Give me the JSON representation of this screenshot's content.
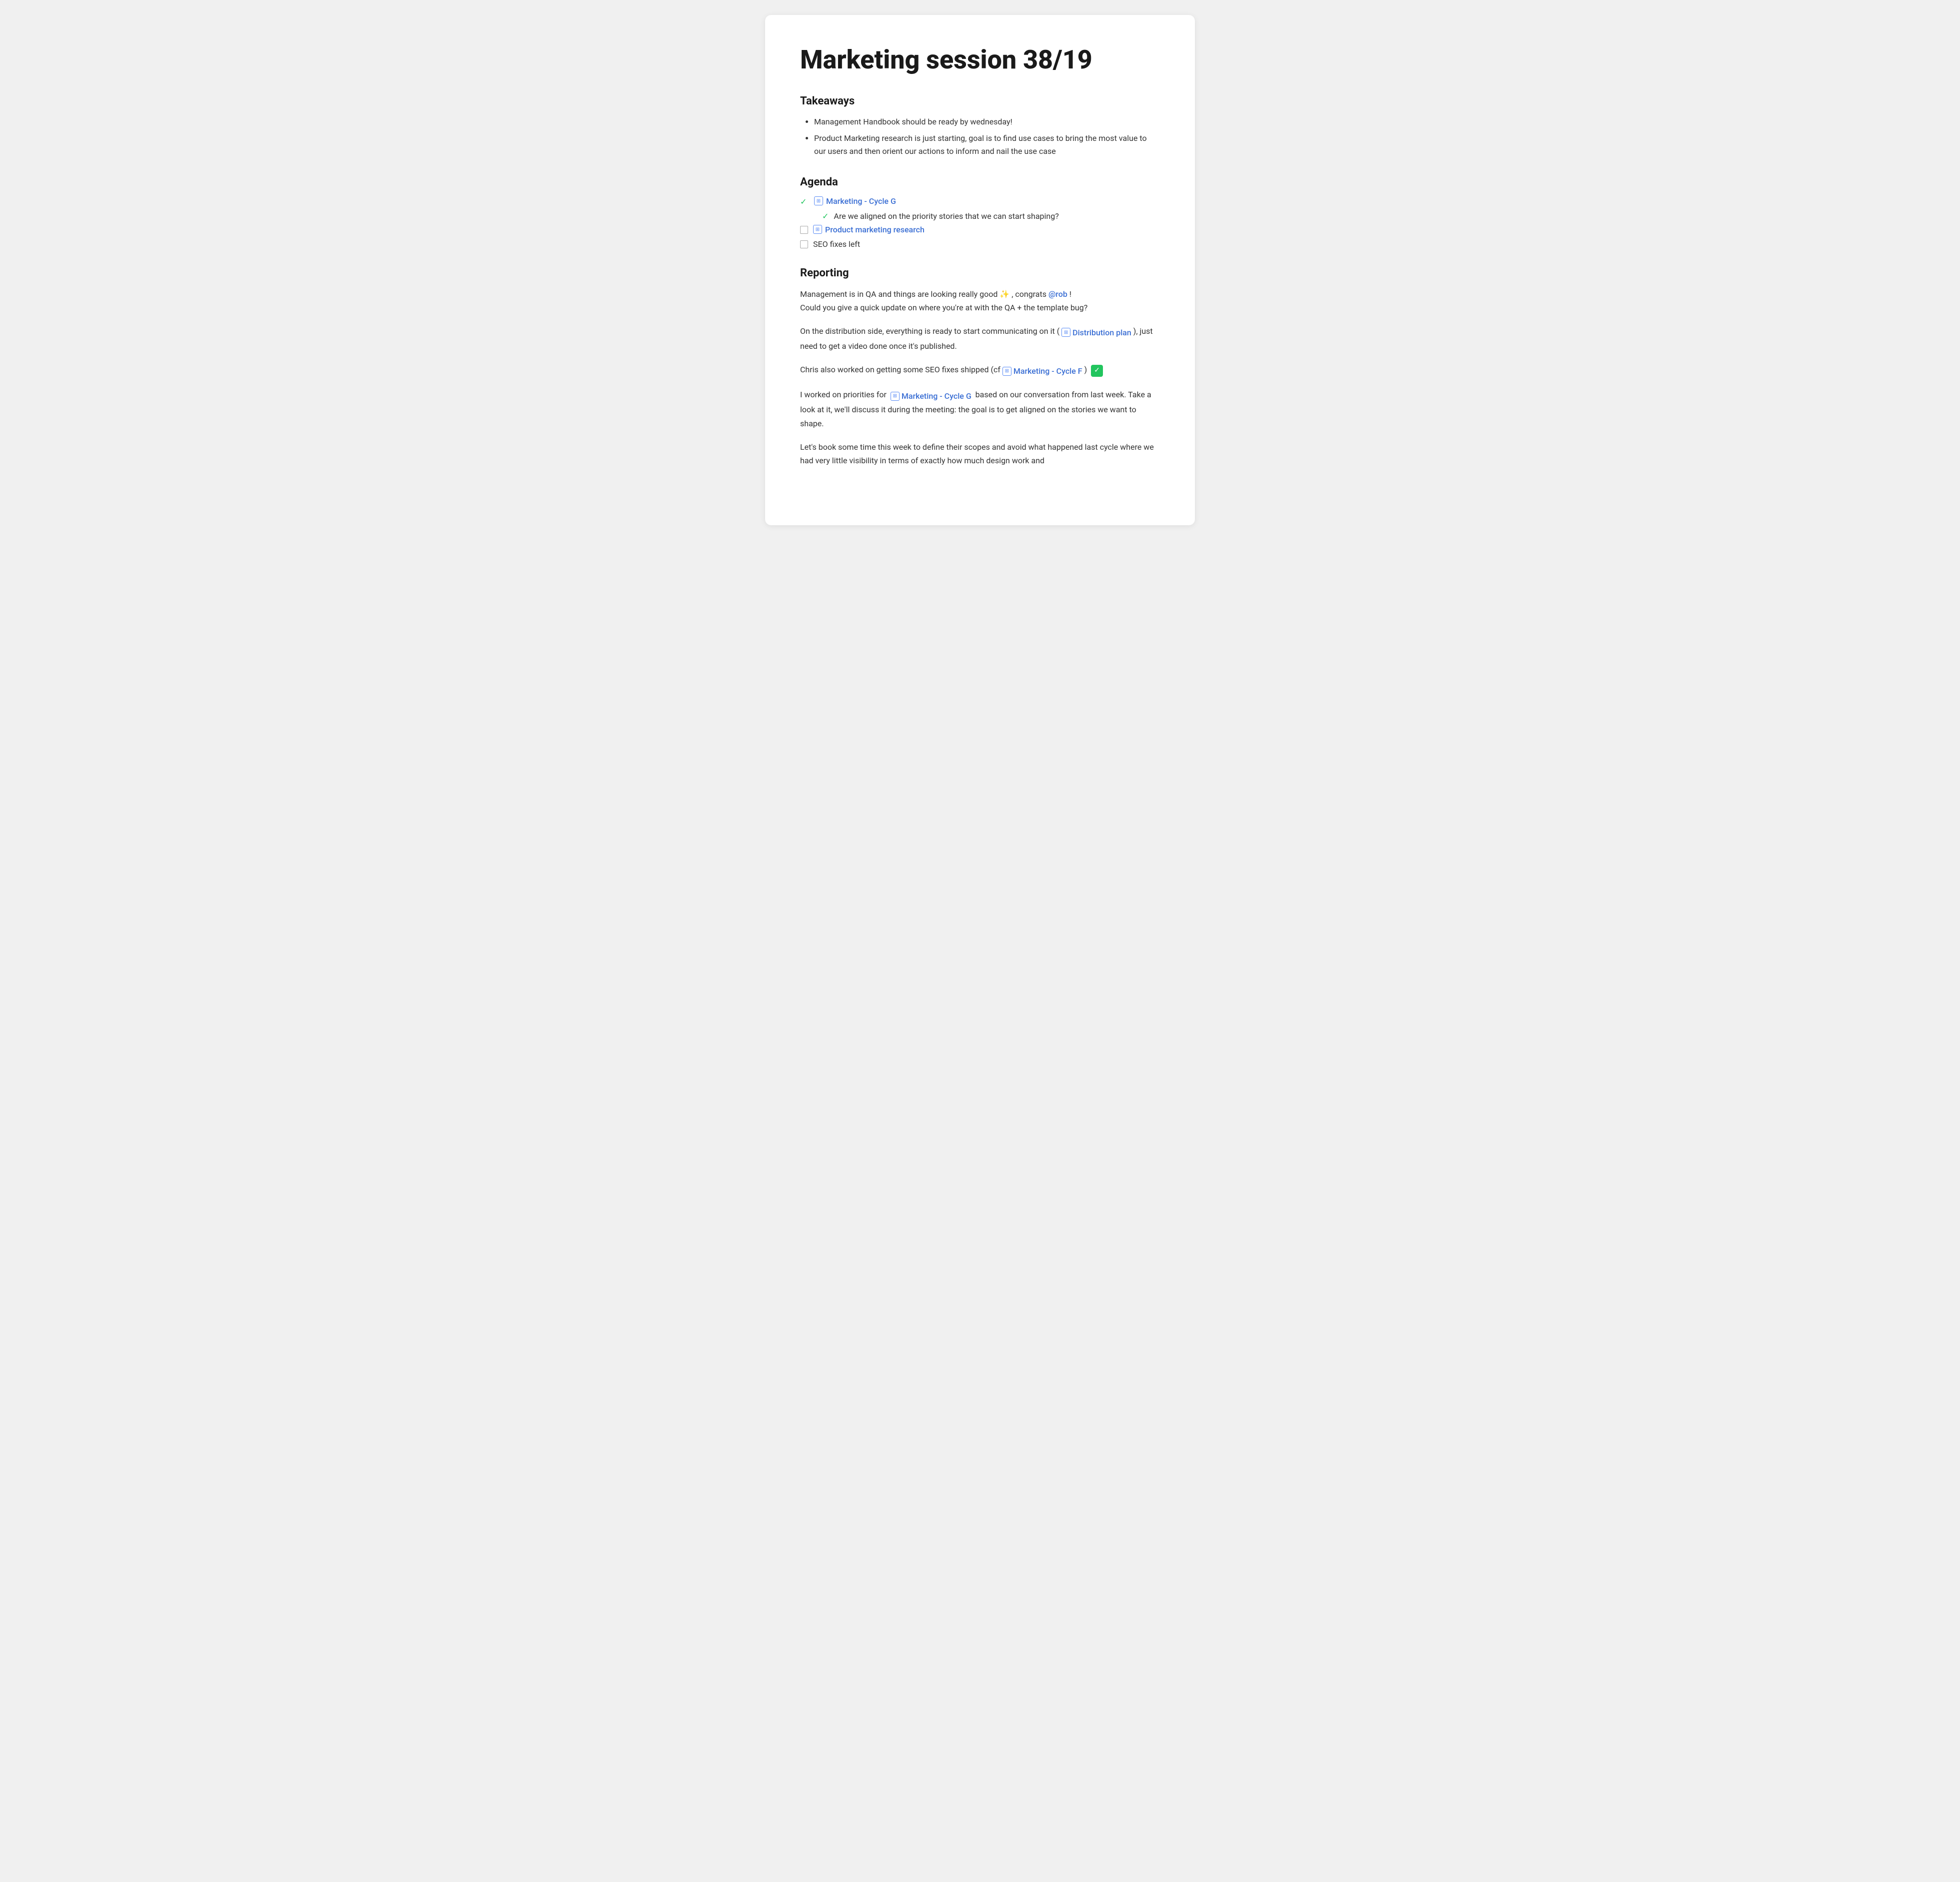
{
  "page": {
    "title": "Marketing session 38/19",
    "takeaways": {
      "heading": "Takeaways",
      "items": [
        "Management Handbook should be ready by wednesday!",
        "Product Marketing research is just starting, goal is to find use cases to bring the most value to our users and then orient our actions to inform and nail the use case"
      ]
    },
    "agenda": {
      "heading": "Agenda",
      "items": [
        {
          "id": "agenda-1",
          "checked": true,
          "icon": true,
          "link_text": "Marketing - Cycle G",
          "sub_items": [
            {
              "checked": true,
              "text": "Are we aligned on the priority stories that we can start shaping?"
            }
          ]
        },
        {
          "id": "agenda-2",
          "checked": false,
          "icon": true,
          "link_text": "Product marketing research",
          "sub_items": []
        },
        {
          "id": "agenda-3",
          "checked": false,
          "icon": false,
          "text": "SEO fixes left",
          "sub_items": []
        }
      ]
    },
    "reporting": {
      "heading": "Reporting",
      "paragraphs": [
        {
          "id": "p1",
          "parts": [
            {
              "type": "text",
              "value": "Management is in QA and things are looking really good "
            },
            {
              "type": "emoji",
              "value": "✨"
            },
            {
              "type": "text",
              "value": " , congrats "
            },
            {
              "type": "mention",
              "value": "@rob"
            },
            {
              "type": "text",
              "value": " !"
            },
            {
              "type": "br"
            },
            {
              "type": "text",
              "value": "Could you give a quick update on where you're at with the QA + the template bug?"
            }
          ]
        },
        {
          "id": "p2",
          "parts": [
            {
              "type": "text",
              "value": "On the distribution side, everything is ready to start communicating on it ( "
            },
            {
              "type": "link_icon"
            },
            {
              "type": "link",
              "value": "Distribution plan"
            },
            {
              "type": "text",
              "value": " ), just need to get a video done once it's published."
            }
          ]
        },
        {
          "id": "p3",
          "parts": [
            {
              "type": "text",
              "value": "Chris also worked on getting some SEO fixes shipped (cf "
            },
            {
              "type": "link_icon"
            },
            {
              "type": "link",
              "value": "Marketing - Cycle F"
            },
            {
              "type": "text",
              "value": " ) "
            },
            {
              "type": "green_check"
            }
          ]
        },
        {
          "id": "p4",
          "parts": [
            {
              "type": "text",
              "value": "I worked on priorities for  "
            },
            {
              "type": "link_icon"
            },
            {
              "type": "link",
              "value": "Marketing - Cycle G"
            },
            {
              "type": "text",
              "value": "  based on our conversation from last week. Take a look at it, we'll discuss it during the meeting: the goal is to get aligned on the stories we want to shape."
            }
          ]
        },
        {
          "id": "p5",
          "parts": [
            {
              "type": "text",
              "value": "Let's book some time this week to define their scopes and avoid what happened last cycle where we had very little visibility in terms of exactly how much design work and"
            }
          ]
        }
      ]
    }
  }
}
